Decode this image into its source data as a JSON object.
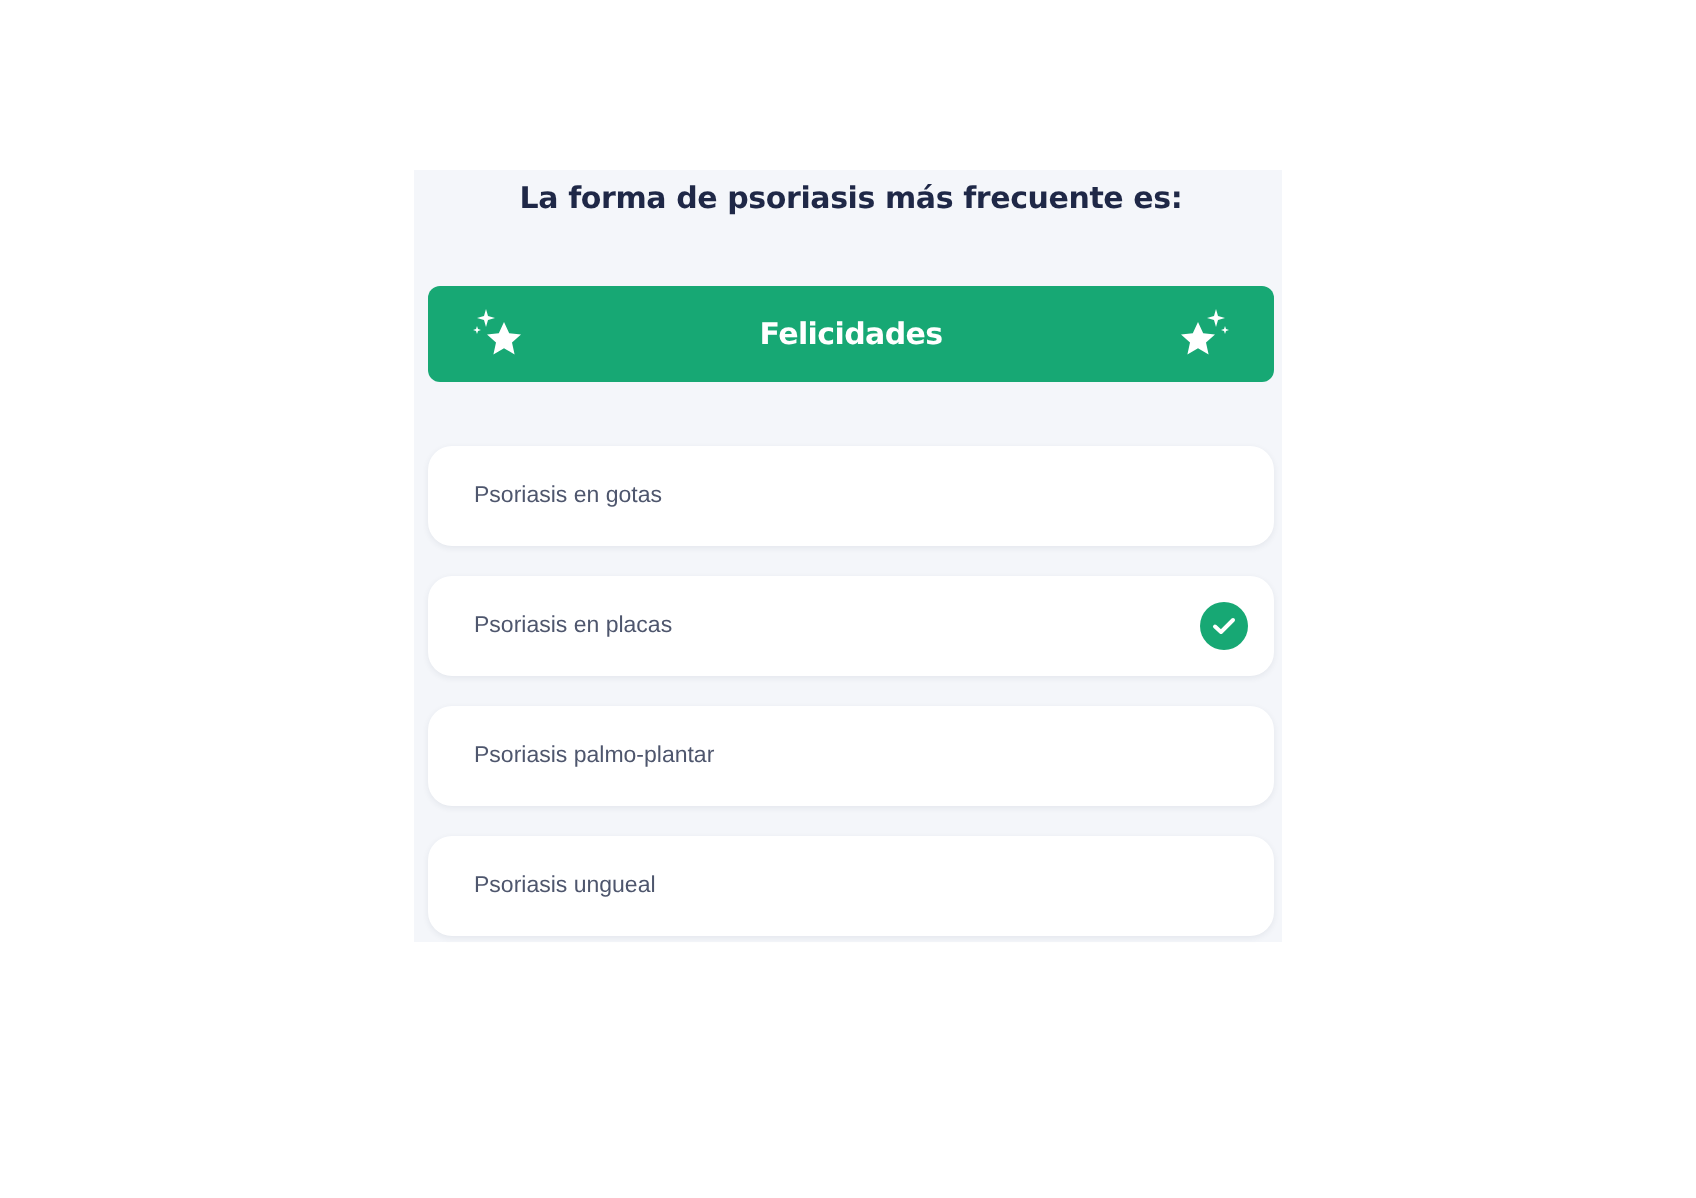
{
  "question": "La forma de psoriasis más frecuente es:",
  "banner": {
    "text": "Felicidades"
  },
  "options": [
    {
      "label": "Psoriasis en gotas",
      "selected": false
    },
    {
      "label": "Psoriasis en placas",
      "selected": true
    },
    {
      "label": "Psoriasis palmo-plantar",
      "selected": false
    },
    {
      "label": "Psoriasis ungueal",
      "selected": false
    }
  ]
}
